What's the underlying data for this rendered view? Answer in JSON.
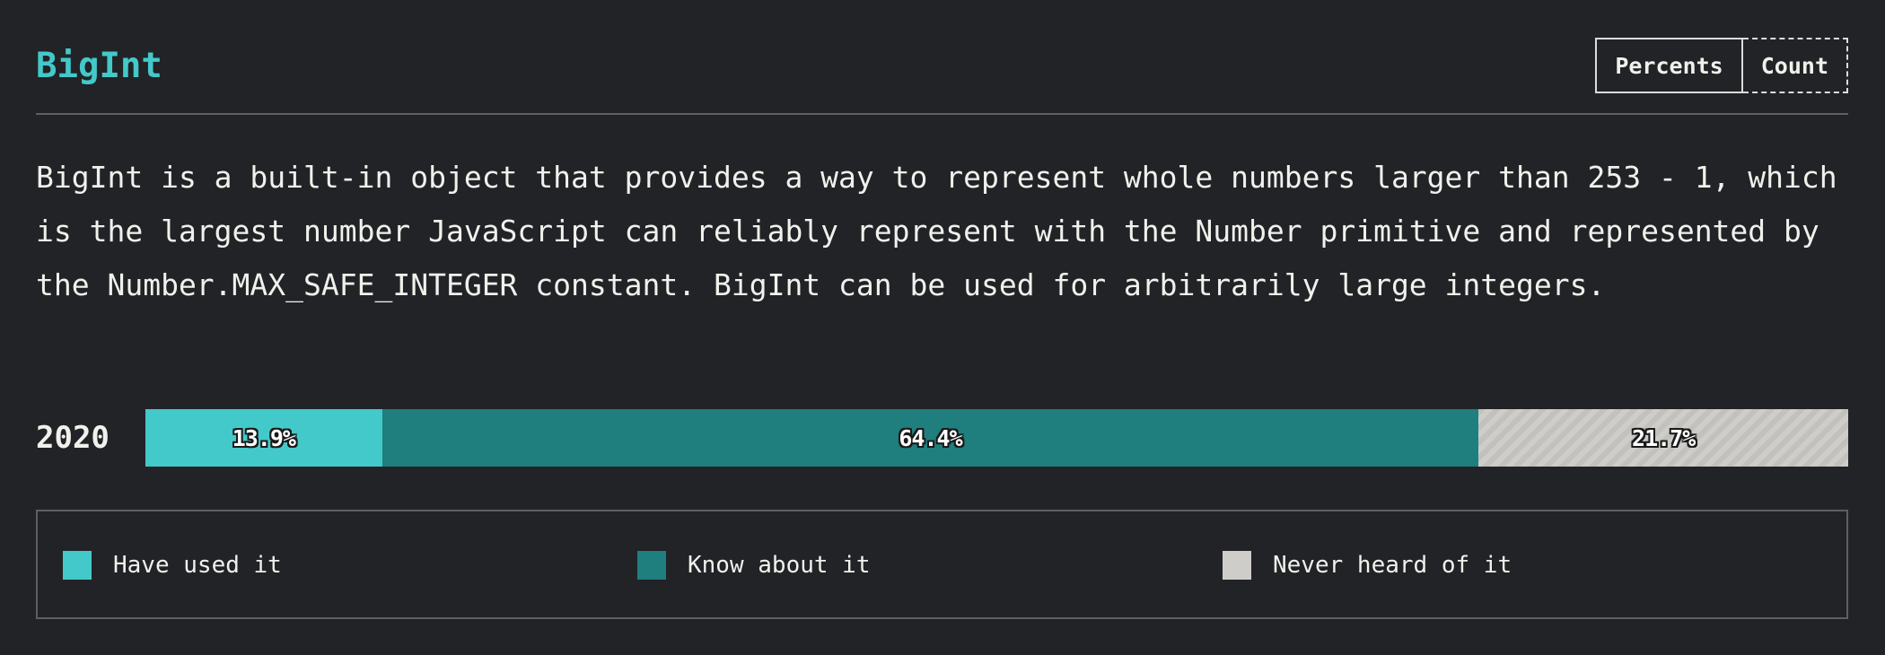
{
  "block": {
    "title": "BigInt",
    "description": "BigInt is a built-in object that provides a way to represent whole numbers larger than 253 - 1, which is the largest number JavaScript can reliably represent with the Number primitive and represented by the Number.MAX_SAFE_INTEGER constant. BigInt can be used for arbitrarily large integers."
  },
  "units_toggle": {
    "percents_label": "Percents",
    "count_label": "Count",
    "selected": "Percents"
  },
  "colors": {
    "title": "#43c9c9",
    "have_used": "#43c9c9",
    "know_about": "#1f7e7e",
    "never_heard": "#cfcdc9",
    "background": "#222327"
  },
  "chart_data": {
    "type": "bar",
    "orientation": "horizontal",
    "stacked": true,
    "categories": [
      "2020"
    ],
    "series": [
      {
        "name": "Have used it",
        "values": [
          13.9
        ],
        "labels": [
          "13.9%"
        ],
        "color": "#43c9c9",
        "pattern": "solid"
      },
      {
        "name": "Know about it",
        "values": [
          64.4
        ],
        "labels": [
          "64.4%"
        ],
        "color": "#1f7e7e",
        "pattern": "solid"
      },
      {
        "name": "Never heard of it",
        "values": [
          21.7
        ],
        "labels": [
          "21.7%"
        ],
        "color": "#cfcdc9",
        "pattern": "hatched"
      }
    ],
    "unit": "%",
    "xlim": [
      0,
      100
    ],
    "legend_position": "bottom"
  }
}
